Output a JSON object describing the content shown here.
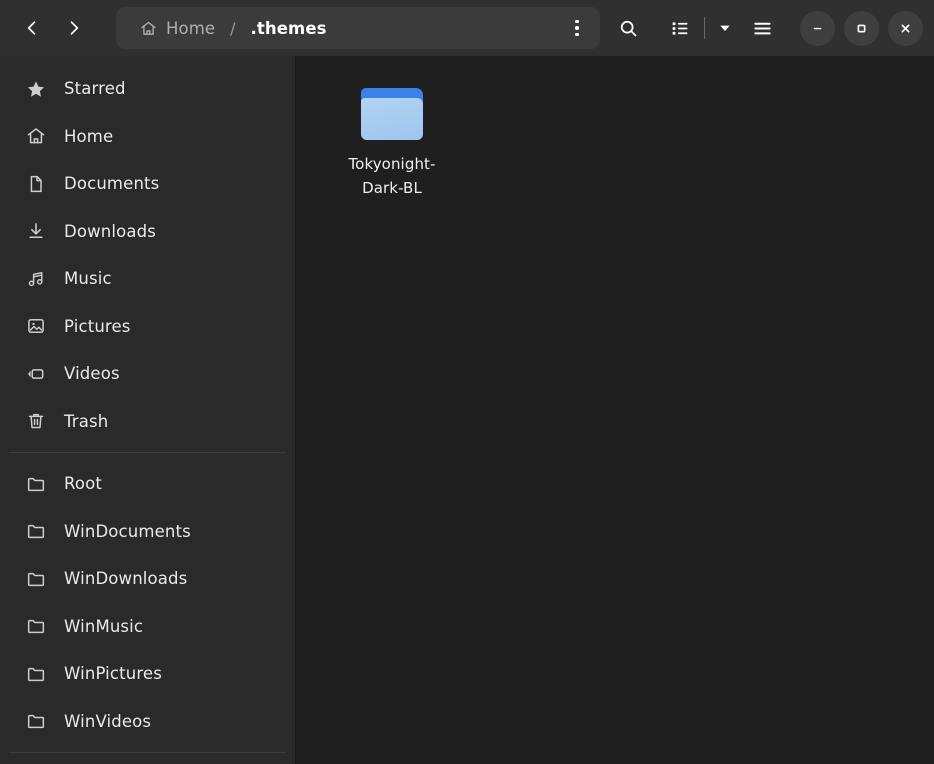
{
  "header": {
    "back_label": "Back",
    "forward_label": "Forward",
    "breadcrumbs": [
      {
        "label": "Home",
        "icon": "home-icon",
        "current": false
      },
      {
        "label": ".themes",
        "icon": "",
        "current": true
      }
    ],
    "separator": "/",
    "path_menu_label": "Path options",
    "search_label": "Search",
    "view_list_label": "List view",
    "view_options_label": "View options",
    "menu_label": "Main menu",
    "window_controls": {
      "minimize": "Minimize",
      "maximize": "Maximize",
      "close": "Close"
    }
  },
  "sidebar": {
    "groups": [
      {
        "items": [
          {
            "label": "Starred",
            "icon": "star-icon"
          },
          {
            "label": "Home",
            "icon": "home-icon"
          },
          {
            "label": "Documents",
            "icon": "document-icon"
          },
          {
            "label": "Downloads",
            "icon": "download-icon"
          },
          {
            "label": "Music",
            "icon": "music-icon"
          },
          {
            "label": "Pictures",
            "icon": "picture-icon"
          },
          {
            "label": "Videos",
            "icon": "video-icon"
          },
          {
            "label": "Trash",
            "icon": "trash-icon"
          }
        ]
      },
      {
        "items": [
          {
            "label": "Root",
            "icon": "folder-icon"
          },
          {
            "label": "WinDocuments",
            "icon": "folder-icon"
          },
          {
            "label": "WinDownloads",
            "icon": "folder-icon"
          },
          {
            "label": "WinMusic",
            "icon": "folder-icon"
          },
          {
            "label": "WinPictures",
            "icon": "folder-icon"
          },
          {
            "label": "WinVideos",
            "icon": "folder-icon"
          }
        ]
      }
    ]
  },
  "content": {
    "files": [
      {
        "name": "Tokyonight-Dark-BL",
        "icon": "folder-icon",
        "type": "folder"
      }
    ]
  },
  "colors": {
    "header_bg": "#303030",
    "sidebar_bg": "#2a2a2a",
    "content_bg": "#1f1f1f",
    "pathbar_bg": "#3b3b3b",
    "folder_blue": "#3b82e8",
    "folder_light": "#a8cdf0"
  }
}
